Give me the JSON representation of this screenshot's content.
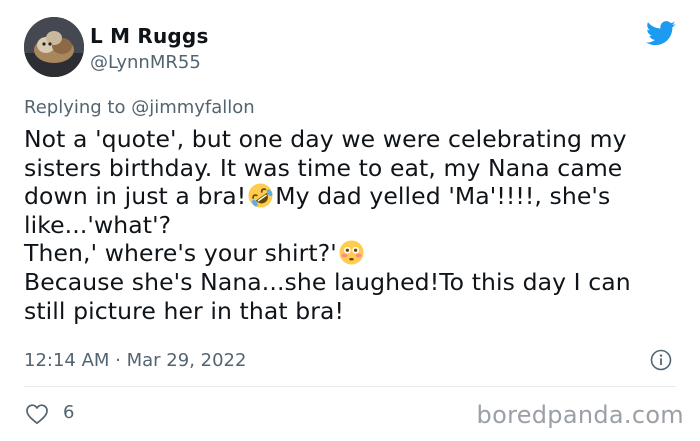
{
  "author": {
    "display_name": "L M Ruggs",
    "handle": "@LynnMR55"
  },
  "reply_to": {
    "prefix": "Replying to ",
    "mention": "@jimmyfallon"
  },
  "tweet": {
    "line1": "Not a 'quote', but one day we were celebrating my",
    "line2": "sisters birthday. It was time to eat, my Nana came",
    "line3a": "down in just a bra!",
    "line3b": "My dad yelled 'Ma'!!!!, she's",
    "line4": "like...'what'?",
    "line5": "Then,' where's your shirt?'",
    "line6": "Because she's Nana...she laughed!To this day I can",
    "line7": "still picture her in that bra!"
  },
  "emojis": {
    "laughing": "rolling-on-floor-laughing-emoji",
    "flushed": "flushed-face-emoji"
  },
  "meta": {
    "timestamp": "12:14 AM · Mar 29, 2022"
  },
  "engagement": {
    "likes": "6"
  },
  "watermark": "boredpanda.com",
  "colors": {
    "twitter_blue": "#1d9bf0",
    "secondary_text": "#536471"
  }
}
